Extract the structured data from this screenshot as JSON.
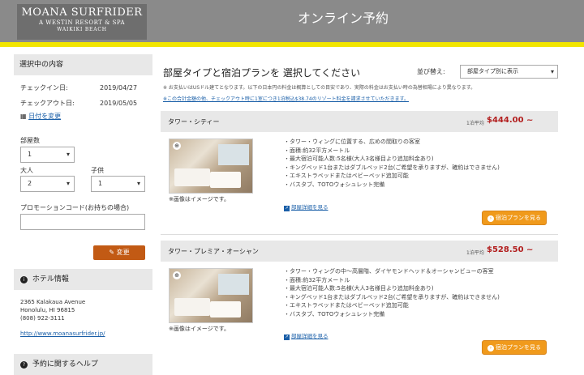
{
  "header": {
    "logo": {
      "line1": "MOANA SURFRIDER",
      "line2": "A WESTIN RESORT & SPA",
      "line3": "WAIKIKI BEACH"
    },
    "title": "オンライン予約"
  },
  "sidebar": {
    "selection_title": "選択中の内容",
    "checkin_label": "チェックイン日:",
    "checkin_value": "2019/04/27",
    "checkout_label": "チェックアウト日:",
    "checkout_value": "2019/05/05",
    "change_dates_link": "日付を変更",
    "rooms_label": "部屋数",
    "rooms_value": "1",
    "adults_label": "大人",
    "adults_value": "2",
    "children_label": "子供",
    "children_value": "1",
    "promo_label": "プロモーションコード(お持ちの場合)",
    "promo_value": "",
    "change_button": "変更",
    "hotel_info_title": "ホテル情報",
    "address_line1": "2365 Kalakaua Avenue",
    "address_line2": "Honolulu, HI 96815",
    "phone": "(808) 922-3111",
    "website": "http://www.moanasurfrider.jp/",
    "help_title": "予約に関するヘルプ"
  },
  "main": {
    "title": "部屋タイプと宿泊プランを 選択してください",
    "sort_label": "並び替え:",
    "sort_value": "部屋タイプ別に表示",
    "note1": "※ お支払いはUSドル建てとなります。以下の日本円の料金は概算としての目安であり、実際の料金はお支払い時の為替相場により異なります。",
    "note2": "※この合計金額の他、チェックアウト時に1室につき1泊税込$38.74のリゾート料金を請求させていただきます。",
    "rooms": [
      {
        "name": "タワー・シティー",
        "avg_label": "1泊平均",
        "price": "$444.00 ~",
        "photo_note": "※画像はイメージです。",
        "features": [
          "・タワー・ウィングに位置する、広めの間取りの客室",
          "・面積:約32平方メートル",
          "・最大宿泊可能人数:5名様(大人3名様目より追加料金あり)",
          "・キングベッド1台またはダブルベッド2台(ご希望を承りますが、確約はできません)",
          "・エキストラベッドまたはベビーベッド追加可能",
          "・バスタブ、TOTOウォシュレット完備"
        ],
        "detail_link": "部屋詳細を見る",
        "plan_button": "宿泊プランを見る"
      },
      {
        "name": "タワー・プレミア・オーシャン",
        "avg_label": "1泊平均",
        "price": "$528.50 ~",
        "photo_note": "※画像はイメージです。",
        "features": [
          "・タワー・ウィングの中～高層階、ダイヤモンドヘッド＆オーシャンビューの客室",
          "・面積:約32平方メートル",
          "・最大宿泊可能人数:5名様(大人3名様目より追加料金あり)",
          "・キングベッド1台またはダブルベッド2台(ご希望を承りますが、確約はできません)",
          "・エキストラベッドまたはベビーベッド追加可能",
          "・バスタブ、TOTOウォシュレット完備"
        ],
        "detail_link": "部屋詳細を見る",
        "plan_button": "宿泊プランを見る"
      }
    ]
  },
  "colors": {
    "accent_orange": "#f09a1c",
    "button_brown": "#c25a14",
    "price_red": "#b21d1d",
    "header_gray": "#8a8a8a",
    "stripe_yellow": "#f2e500"
  },
  "icons": [
    "zoom-icon",
    "info-icon",
    "detail-icon",
    "arrow-right-icon",
    "chevron-down-icon"
  ]
}
